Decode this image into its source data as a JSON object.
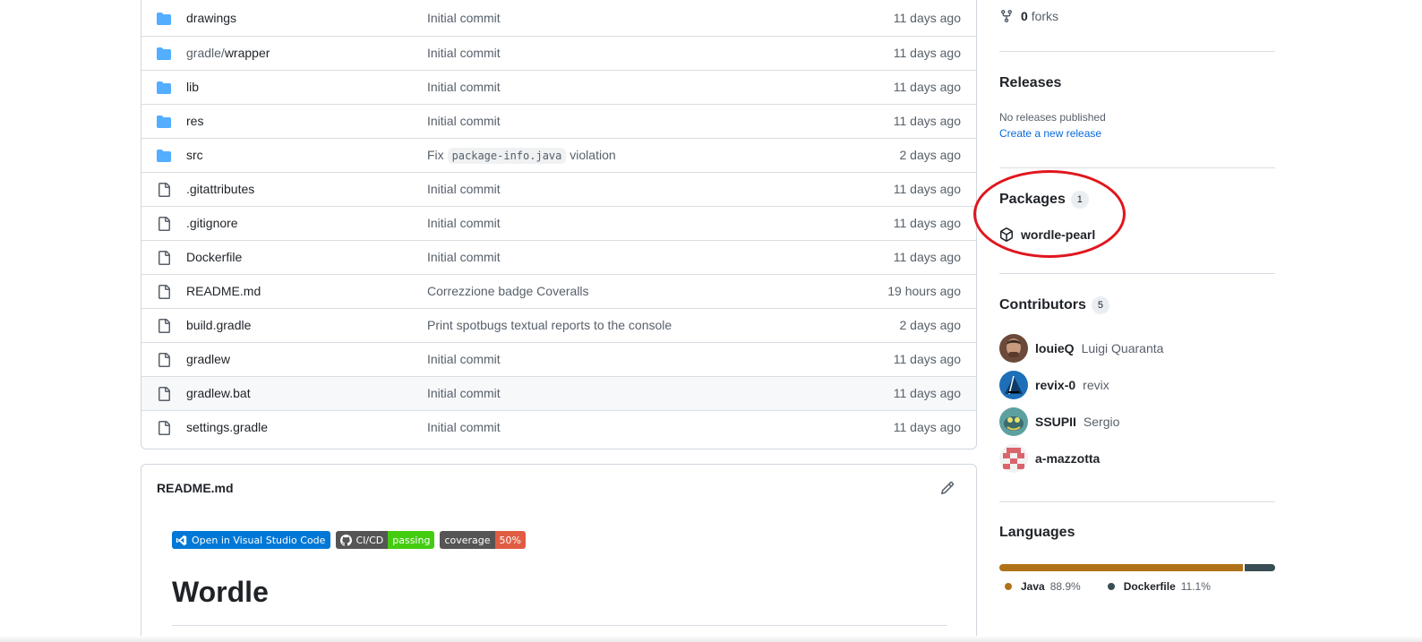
{
  "files": [
    {
      "type": "dir",
      "name_prefix": "",
      "name": "drawings",
      "message": "Initial commit",
      "code": "",
      "message_after": "",
      "date": "11 days ago"
    },
    {
      "type": "dir",
      "name_prefix": "gradle/",
      "name": "wrapper",
      "message": "Initial commit",
      "code": "",
      "message_after": "",
      "date": "11 days ago"
    },
    {
      "type": "dir",
      "name_prefix": "",
      "name": "lib",
      "message": "Initial commit",
      "code": "",
      "message_after": "",
      "date": "11 days ago"
    },
    {
      "type": "dir",
      "name_prefix": "",
      "name": "res",
      "message": "Initial commit",
      "code": "",
      "message_after": "",
      "date": "11 days ago"
    },
    {
      "type": "dir",
      "name_prefix": "",
      "name": "src",
      "message": "Fix",
      "code": "package-info.java",
      "message_after": "violation",
      "date": "2 days ago"
    },
    {
      "type": "file",
      "name_prefix": "",
      "name": ".gitattributes",
      "message": "Initial commit",
      "code": "",
      "message_after": "",
      "date": "11 days ago"
    },
    {
      "type": "file",
      "name_prefix": "",
      "name": ".gitignore",
      "message": "Initial commit",
      "code": "",
      "message_after": "",
      "date": "11 days ago"
    },
    {
      "type": "file",
      "name_prefix": "",
      "name": "Dockerfile",
      "message": "Initial commit",
      "code": "",
      "message_after": "",
      "date": "11 days ago"
    },
    {
      "type": "file",
      "name_prefix": "",
      "name": "README.md",
      "message": "Correzzione badge Coveralls",
      "code": "",
      "message_after": "",
      "date": "19 hours ago"
    },
    {
      "type": "file",
      "name_prefix": "",
      "name": "build.gradle",
      "message": "Print spotbugs textual reports to the console",
      "code": "",
      "message_after": "",
      "date": "2 days ago"
    },
    {
      "type": "file",
      "name_prefix": "",
      "name": "gradlew",
      "message": "Initial commit",
      "code": "",
      "message_after": "",
      "date": "11 days ago"
    },
    {
      "type": "file",
      "name_prefix": "",
      "name": "gradlew.bat",
      "message": "Initial commit",
      "code": "",
      "message_after": "",
      "date": "11 days ago"
    },
    {
      "type": "file",
      "name_prefix": "",
      "name": "settings.gradle",
      "message": "Initial commit",
      "code": "",
      "message_after": "",
      "date": "11 days ago"
    }
  ],
  "readme": {
    "title": "README.md",
    "badges": {
      "vscode": "Open in Visual Studio Code",
      "cicd_label": "CI/CD",
      "cicd_status": "passing",
      "coverage_label": "coverage",
      "coverage_value": "50%"
    },
    "heading": "Wordle"
  },
  "sidebar": {
    "forks_count": "0",
    "forks_label": "forks",
    "releases": {
      "title": "Releases",
      "empty_text": "No releases published",
      "create_link": "Create a new release"
    },
    "packages": {
      "title": "Packages",
      "count": "1",
      "items": [
        {
          "name": "wordle-pearl"
        }
      ]
    },
    "contributors": {
      "title": "Contributors",
      "count": "5",
      "items": [
        {
          "login": "louieQ",
          "name": "Luigi Quaranta"
        },
        {
          "login": "revix-0",
          "name": "revix"
        },
        {
          "login": "SSUPII",
          "name": "Sergio"
        },
        {
          "login": "a-mazzotta",
          "name": ""
        }
      ]
    },
    "languages": {
      "title": "Languages",
      "items": [
        {
          "name": "Java",
          "percent": "88.9%",
          "share": 88.9,
          "color": "#b07219"
        },
        {
          "name": "Dockerfile",
          "percent": "11.1%",
          "share": 11.1,
          "color": "#384d54"
        }
      ]
    }
  },
  "annotation": {
    "color": "#e0161d",
    "target": "packages-section"
  }
}
